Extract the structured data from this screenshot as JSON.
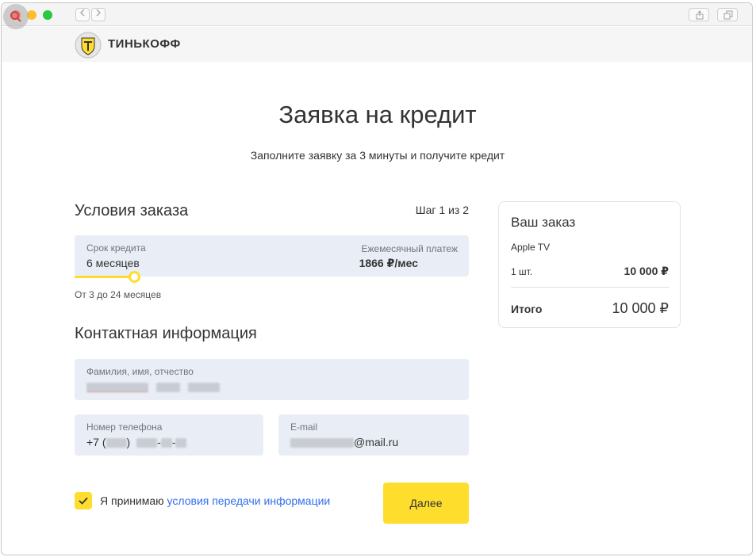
{
  "browser": {
    "back_icon": "chevron-left-icon",
    "forward_icon": "chevron-right-icon",
    "share_icon": "share-icon",
    "tabs_icon": "tabs-icon"
  },
  "site": {
    "logo_text": "ТИНЬКОФФ",
    "brand_color": "#ffdd2d"
  },
  "header": {
    "title": "Заявка на кредит",
    "subtitle": "Заполните заявку за 3 минуты и получите кредит"
  },
  "order_conditions": {
    "title": "Условия заказа",
    "step": "Шаг 1 из 2",
    "term_label": "Срок кредита",
    "term_value": "6 месяцев",
    "payment_label": "Ежемесячный платеж",
    "payment_value": "1866 ₽/мес",
    "range_hint": "От 3 до 24 месяцев",
    "slider_min_months": 3,
    "slider_max_months": 24,
    "slider_value_months": 6
  },
  "contact": {
    "title": "Контактная информация",
    "name_label": "Фамилия, имя, отчество",
    "phone_label": "Номер телефона",
    "phone_prefix": "+7 (",
    "phone_close": ")",
    "phone_dash": "-",
    "email_label": "E-mail",
    "email_suffix": "@mail.ru"
  },
  "consent": {
    "text": "Я принимаю ",
    "link_text": "условия передачи информации",
    "checked": true
  },
  "next_button": "Далее",
  "order_summary": {
    "title": "Ваш заказ",
    "product": "Apple TV",
    "quantity": "1 шт.",
    "price": "10 000 ₽",
    "total_label": "Итого",
    "total_value": "10 000 ₽"
  }
}
